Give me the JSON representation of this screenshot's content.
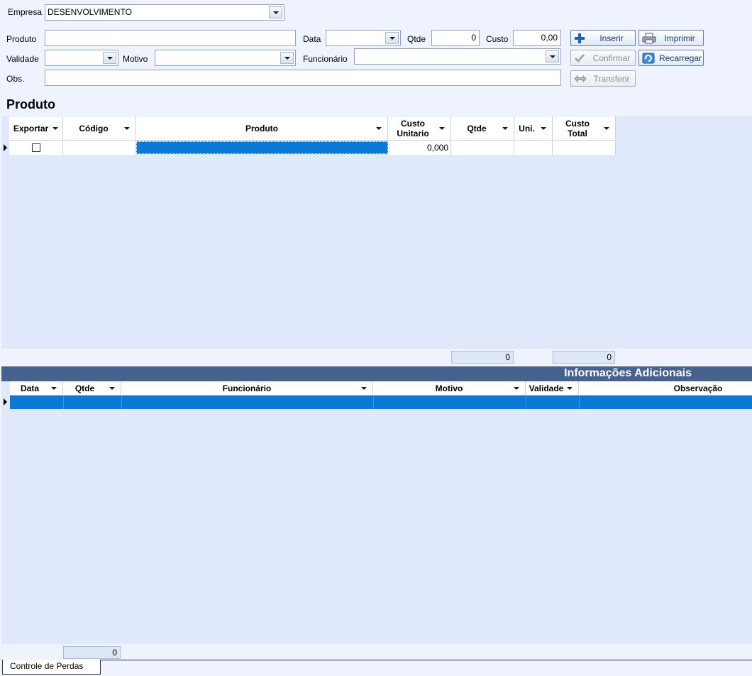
{
  "form": {
    "empresa_label": "Empresa",
    "empresa_value": "DESENVOLVIMENTO",
    "produto_label": "Produto",
    "produto_value": "",
    "data_label": "Data",
    "data_value": "",
    "qtde_label": "Qtde",
    "qtde_value": "0",
    "custo_label": "Custo",
    "custo_value": "0,00",
    "validade_label": "Validade",
    "validade_value": "",
    "motivo_label": "Motivo",
    "motivo_value": "",
    "funcionario_label": "Funcionário",
    "funcionario_value": "",
    "obs_label": "Obs.",
    "obs_value": ""
  },
  "buttons": {
    "inserir": "Inserir",
    "imprimir": "Imprimir",
    "confirmar": "Confirmar",
    "recarregar": "Recarregar",
    "transferir": "Transferir"
  },
  "product_grid": {
    "title": "Produto",
    "columns": {
      "exportar": "Exportar",
      "codigo": "Código",
      "produto": "Produto",
      "custo_unitario_line1": "Custo",
      "custo_unitario_line2": "Unitario",
      "qtde": "Qtde",
      "uni": "Uni.",
      "custo_total_line1": "Custo",
      "custo_total_line2": "Total"
    },
    "row": {
      "exportar_checked": false,
      "codigo": "",
      "produto": "",
      "custo_unitario": "0,000",
      "qtde": "",
      "uni": "",
      "custo_total": ""
    },
    "summary": {
      "qtde_total": "0",
      "custo_total": "0"
    }
  },
  "info_grid": {
    "title": "Informações Adicionais",
    "columns": {
      "data": "Data",
      "qtde": "Qtde",
      "funcionario": "Funcionário",
      "motivo": "Motivo",
      "validade": "Validade",
      "observacao": "Observação"
    },
    "summary": {
      "qtde_total": "0"
    }
  },
  "tabs": {
    "active": "Controle de Perdas"
  },
  "colors": {
    "background": "#eef3fd",
    "grid_background": "#e0e9fb",
    "selection": "#0a7ad6",
    "header_bar": "#47628f"
  }
}
